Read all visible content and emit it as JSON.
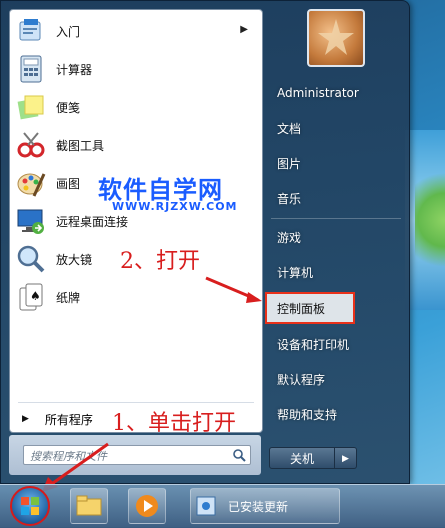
{
  "left_programs": [
    {
      "label": "入门",
      "has_arrow": true,
      "icon": "getting-started-icon"
    },
    {
      "label": "计算器",
      "has_arrow": false,
      "icon": "calculator-icon"
    },
    {
      "label": "便笺",
      "has_arrow": false,
      "icon": "sticky-notes-icon"
    },
    {
      "label": "截图工具",
      "has_arrow": false,
      "icon": "snipping-tool-icon"
    },
    {
      "label": "画图",
      "has_arrow": false,
      "icon": "paint-icon"
    },
    {
      "label": "远程桌面连接",
      "has_arrow": false,
      "icon": "remote-desktop-icon"
    },
    {
      "label": "放大镜",
      "has_arrow": false,
      "icon": "magnifier-icon"
    },
    {
      "label": "纸牌",
      "has_arrow": false,
      "icon": "solitaire-icon"
    }
  ],
  "all_programs_label": "所有程序",
  "search_placeholder": "搜索程序和文件",
  "right_items": [
    {
      "label": "Administrator"
    },
    {
      "label": "文档"
    },
    {
      "label": "图片"
    },
    {
      "label": "音乐"
    },
    {
      "label": "游戏"
    },
    {
      "label": "计算机"
    },
    {
      "label": "控制面板"
    },
    {
      "label": "设备和打印机"
    },
    {
      "label": "默认程序"
    },
    {
      "label": "帮助和支持"
    }
  ],
  "shutdown_label": "关机",
  "watermark_title": "软件自学网",
  "watermark_url": "WWW.RJZXW.COM",
  "annotation_step1": "1、单击打开",
  "annotation_step2": "2、打开",
  "taskbar_window_label": "已安装更新",
  "colors": {
    "highlight": "#e8311a",
    "annotation": "#d81e1e",
    "watermark": "#1a5cff"
  }
}
